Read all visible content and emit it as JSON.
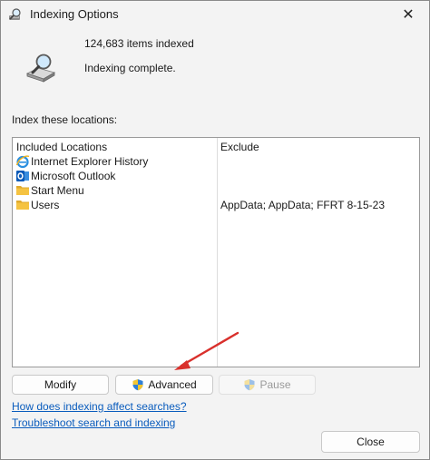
{
  "window": {
    "title": "Indexing Options",
    "close_glyph": "✕"
  },
  "status": {
    "items_indexed": "124,683 items indexed",
    "message": "Indexing complete.",
    "icon": "indexing-magnifier-drive-icon"
  },
  "locations": {
    "label": "Index these locations:",
    "columns": {
      "included": "Included Locations",
      "exclude": "Exclude"
    },
    "rows": [
      {
        "name": "Internet Explorer History",
        "exclude": "",
        "icon": "internet-explorer-icon"
      },
      {
        "name": "Microsoft Outlook",
        "exclude": "",
        "icon": "outlook-icon"
      },
      {
        "name": "Start Menu",
        "exclude": "",
        "icon": "folder-icon"
      },
      {
        "name": "Users",
        "exclude": "AppData; AppData; FFRT 8-15-23",
        "icon": "folder-icon"
      }
    ]
  },
  "buttons": {
    "modify": "Modify",
    "advanced": "Advanced",
    "pause": "Pause",
    "close": "Close"
  },
  "links": {
    "how_indexing": "How does indexing affect searches?",
    "troubleshoot": "Troubleshoot search and indexing"
  },
  "colors": {
    "link": "#0a5cbd",
    "annotation_arrow": "#d9302c",
    "folder": "#f5c342"
  }
}
